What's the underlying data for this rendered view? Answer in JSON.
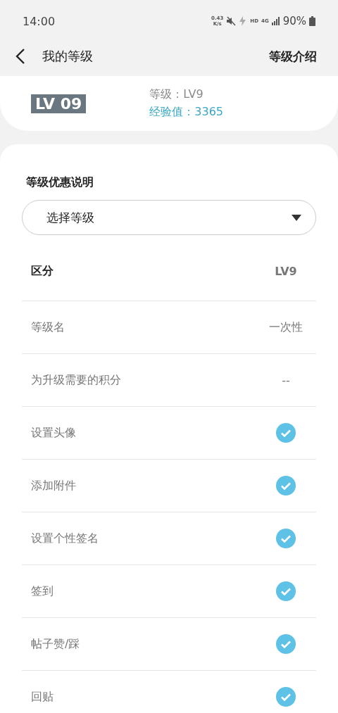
{
  "status_bar": {
    "time": "14:00",
    "speed_value": "0.43",
    "speed_unit": "K/s",
    "hd": "HD",
    "network": "4G",
    "battery": "90%"
  },
  "header": {
    "title": "我的等级",
    "action": "等级介绍"
  },
  "level_card": {
    "badge": "LV 09",
    "level": "等级：LV9",
    "exp": "经验值：3365"
  },
  "section": {
    "title": "等级优惠说明",
    "dropdown": "选择等级"
  },
  "table": {
    "columns": [
      "区分",
      "LV9"
    ],
    "rows": [
      {
        "label": "等级名",
        "kind": "text",
        "value": "一次性"
      },
      {
        "label": "为升级需要的积分",
        "kind": "text",
        "value": "--"
      },
      {
        "label": "设置头像",
        "kind": "check",
        "checked": true
      },
      {
        "label": "添加附件",
        "kind": "check",
        "checked": true
      },
      {
        "label": "设置个性签名",
        "kind": "check",
        "checked": true
      },
      {
        "label": "签到",
        "kind": "check",
        "checked": true
      },
      {
        "label": "帖子赞/踩",
        "kind": "check",
        "checked": true
      },
      {
        "label": "回贴",
        "kind": "check",
        "checked": true
      }
    ]
  }
}
